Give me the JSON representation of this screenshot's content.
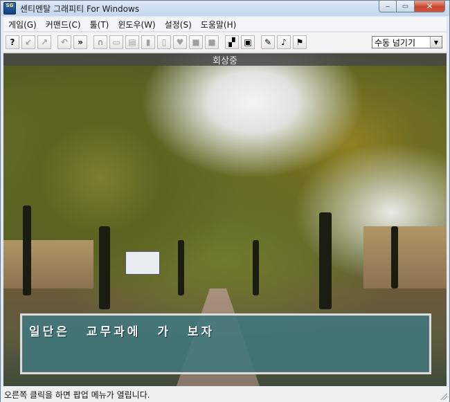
{
  "window": {
    "title": "센티멘탈 그래피티 For Windows",
    "app_icon_text": "SG",
    "minimize_glyph": "‒",
    "maximize_glyph": "▭",
    "close_glyph": "✕"
  },
  "menu": [
    {
      "label": "게임(G)"
    },
    {
      "label": "커맨드(C)"
    },
    {
      "label": "툴(T)"
    },
    {
      "label": "윈도우(W)"
    },
    {
      "label": "설정(S)"
    },
    {
      "label": "도움말(H)"
    }
  ],
  "toolbar": {
    "buttons": [
      {
        "name": "help-icon",
        "glyph": "?",
        "enabled": true
      },
      {
        "name": "shrink-icon",
        "glyph": "↙",
        "enabled": false
      },
      {
        "name": "expand-icon",
        "glyph": "↗",
        "enabled": false
      },
      {
        "name": "undo-icon",
        "glyph": "↶",
        "enabled": false
      },
      {
        "name": "fast-forward-icon",
        "glyph": "»",
        "enabled": true
      },
      {
        "name": "headphones-icon",
        "glyph": "∩",
        "enabled": false
      },
      {
        "name": "log-icon",
        "glyph": "▭",
        "enabled": false
      },
      {
        "name": "save-icon",
        "glyph": "▤",
        "enabled": false
      },
      {
        "name": "phone-icon",
        "glyph": "▮",
        "enabled": false
      },
      {
        "name": "card-icon",
        "glyph": "▯",
        "enabled": false
      },
      {
        "name": "heart-icon",
        "glyph": "♥",
        "enabled": false
      },
      {
        "name": "photo-icon",
        "glyph": "■",
        "enabled": false
      },
      {
        "name": "memo-icon",
        "glyph": "■",
        "enabled": false
      },
      {
        "name": "window-mode-icon",
        "glyph": "▞",
        "enabled": true
      },
      {
        "name": "screen-icon",
        "glyph": "▣",
        "enabled": true
      },
      {
        "name": "settings-wrench-icon",
        "glyph": "✎",
        "enabled": true
      },
      {
        "name": "music-note-icon",
        "glyph": "♪",
        "enabled": true
      },
      {
        "name": "text-speed-icon",
        "glyph": "⚑",
        "enabled": true
      }
    ],
    "mode_select": {
      "value": "수동 넘기기",
      "arrow": "▼"
    }
  },
  "scene": {
    "band_label": "회상중"
  },
  "dialog": {
    "text": "일단은 교무과에 가 보자"
  },
  "status": {
    "text": "오른쪽 클릭을 하면 팝업 메뉴가 열립니다."
  }
}
